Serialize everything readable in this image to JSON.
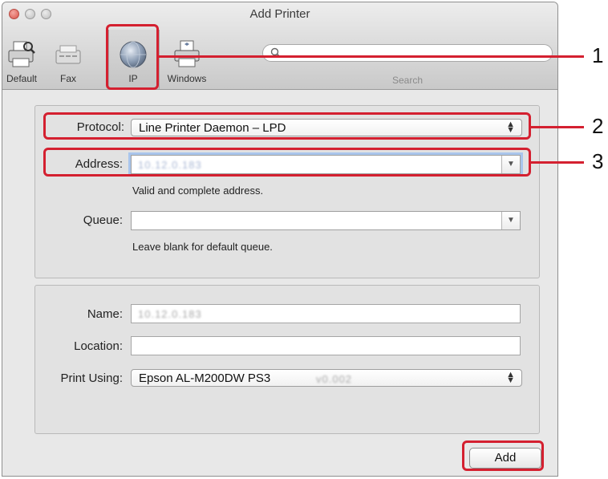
{
  "window": {
    "title": "Add Printer"
  },
  "toolbar": {
    "items": [
      {
        "label": "Default",
        "icon": "default-printer-icon"
      },
      {
        "label": "Fax",
        "icon": "fax-icon"
      },
      {
        "label": "IP",
        "icon": "ip-globe-icon",
        "selected": true
      },
      {
        "label": "Windows",
        "icon": "windows-printer-icon"
      }
    ],
    "search": {
      "placeholder": "",
      "label": "Search"
    }
  },
  "connection": {
    "protocol": {
      "label": "Protocol:",
      "value": "Line Printer Daemon – LPD"
    },
    "address": {
      "label": "Address:",
      "value": "10.12.0.183",
      "hint": "Valid and complete address."
    },
    "queue": {
      "label": "Queue:",
      "value": "",
      "hint": "Leave blank for default queue."
    }
  },
  "printer": {
    "name": {
      "label": "Name:",
      "value": "10.12.0.183"
    },
    "location": {
      "label": "Location:",
      "value": ""
    },
    "print_using": {
      "label": "Print Using:",
      "value": "Epson AL-M200DW PS3",
      "version": "v0.002"
    }
  },
  "actions": {
    "add_label": "Add"
  },
  "callouts": [
    "1",
    "2",
    "3"
  ],
  "colors": {
    "callout": "#d42030",
    "selected_tool_bg": "#c9c9c9"
  }
}
